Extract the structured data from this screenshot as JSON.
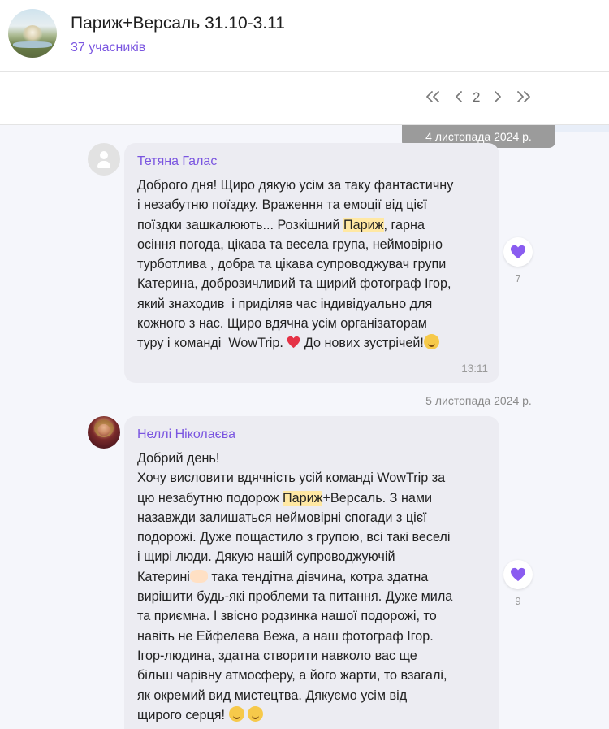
{
  "header": {
    "title": "Париж+Версаль 31.10-3.11",
    "members": "37 учасників"
  },
  "pagination": {
    "first_icon": "double-chevron-left-icon",
    "prev_icon": "chevron-left-icon",
    "current_page": "2",
    "next_icon": "chevron-right-icon",
    "last_icon": "double-chevron-right-icon"
  },
  "dates": {
    "first": "4 листопада 2024 р.",
    "second": "5 листопада 2024 р."
  },
  "messages": [
    {
      "author": "Тетяна Галас",
      "lines": [
        "Доброго дня! Щиро дякую усім за таку фантастичну",
        "і незабутню поїздку. Враження та емоції від цієї",
        "поїздки зашкалюють... Розкішний ",
        "Париж",
        ", гарна",
        "осіння погода, цікава та весела група, неймовірно",
        "турботлива , добра та цікава супроводжувач групи",
        "Катерина, доброзичливий та щирий фотограф Ігор,",
        "який знаходив  і приділяв час індивідуально для",
        "кожного з нас. Щиро вдячна усім організаторам",
        "туру і команді  WowTrip. ",
        " До нових зустрічей!"
      ],
      "time": "13:11",
      "reaction_icon": "purple-heart-icon",
      "reaction_count": "7"
    },
    {
      "author": "Неллі Ніколаєва",
      "lines": [
        "Добрий день!",
        "Хочу висловити вдячність усій команді WowTrip за",
        "цю незабутню подорож ",
        "Париж",
        "+Версаль. З нами",
        "назавжди залишаться неймовірні спогади з цієї",
        "подорожі. Дуже пощастило з групою, всі такі веселі",
        "і щирі люди. Дякую нашій супроводжуючій",
        "Катерині",
        " така тендітна дівчина, котра здатна",
        "вирішити будь-які проблеми та питання. Дуже мила",
        "та приємна. І звісно родзинка нашої подорожі, то",
        "навіть не Ейфелева Вежа, а наш фотограф Ігор.",
        "Ігор-людина, здатна створити навколо вас ще",
        "більш чарівну атмосферу, а його жарти, то взагалі,",
        "як окремий вид мистецтва. Дякуємо усім від",
        "щирого серця! "
      ],
      "reaction_icon": "purple-heart-icon",
      "reaction_count": "9"
    }
  ],
  "colors": {
    "accent": "#7a55e0",
    "highlight": "#ffe8a3",
    "bubble": "#ececf2",
    "feed_bg": "#f5f6fb",
    "date_pill": "#9b9b9b"
  }
}
